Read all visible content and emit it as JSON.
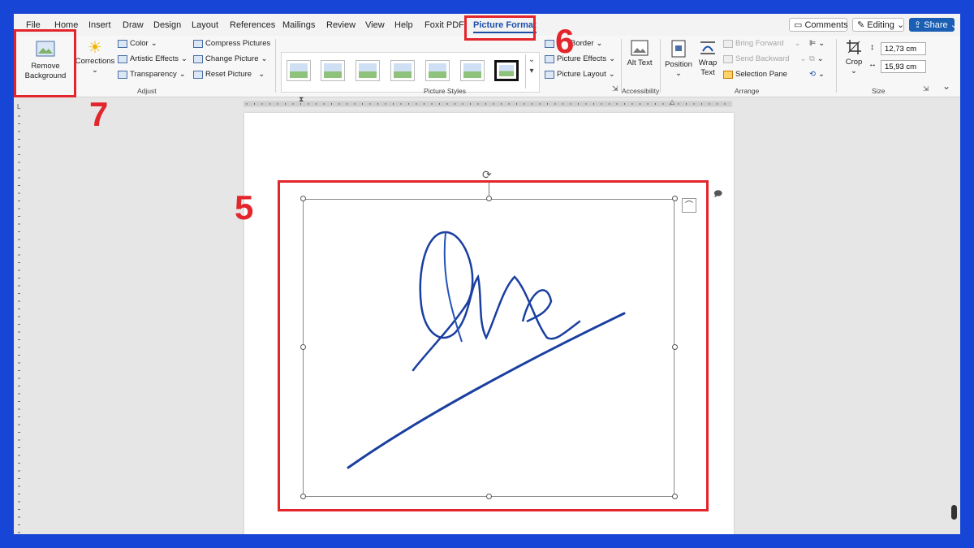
{
  "menu": {
    "tabs": [
      "File",
      "Home",
      "Insert",
      "Draw",
      "Design",
      "Layout",
      "References",
      "Mailings",
      "Review",
      "View",
      "Help",
      "Foxit PDF",
      "Picture Format"
    ],
    "active_tab": "Picture Format",
    "comments_label": "Comments",
    "editing_label": "Editing",
    "share_label": "Share"
  },
  "ribbon": {
    "remove_background": "Remove Background",
    "corrections": "Corrections",
    "color": "Color",
    "artistic_effects": "Artistic Effects",
    "transparency": "Transparency",
    "compress_pictures": "Compress Pictures",
    "change_picture": "Change Picture",
    "reset_picture": "Reset Picture",
    "adjust_label": "Adjust",
    "picture_styles_label": "Picture Styles",
    "picture_border": "Border",
    "picture_effects": "Picture Effects",
    "picture_layout": "Picture Layout",
    "alt_text": "Alt Text",
    "accessibility_label": "Accessibility",
    "position": "Position",
    "wrap_text": "Wrap Text",
    "bring_forward": "Bring Forward",
    "send_backward": "Send Backward",
    "selection_pane": "Selection Pane",
    "arrange_label": "Arrange",
    "crop": "Crop",
    "height": "12,73 cm",
    "width": "15,93 cm",
    "size_label": "Size"
  },
  "annotations": {
    "step5": "5",
    "step6": "6",
    "step7": "7"
  },
  "colors": {
    "frame": "#1746d6",
    "annotation": "#e3262b",
    "accent": "#1a4fa8",
    "ink": "#1a3fa0"
  }
}
